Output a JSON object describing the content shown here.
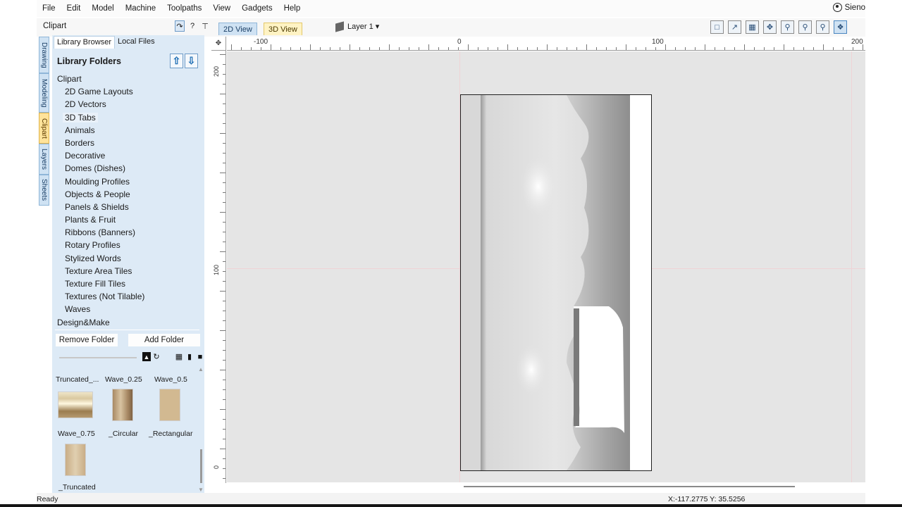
{
  "menu": [
    "File",
    "Edit",
    "Model",
    "Machine",
    "Toolpaths",
    "View",
    "Gadgets",
    "Help"
  ],
  "user": {
    "name": "Sieno"
  },
  "panel": {
    "title": "Clipart",
    "controls": {
      "pin_label": "?",
      "auto_hide": "↑"
    }
  },
  "view_tabs": {
    "tab_2d": "2D View",
    "tab_3d": "3D View"
  },
  "layer": {
    "label": "Layer 1 ▾"
  },
  "toolbar_icons": [
    "fit-view-icon",
    "scale-view-icon",
    "grid-icon",
    "pan-icon",
    "zoom-icon",
    "zoom-box-icon",
    "zoom-extents-icon",
    "vector-toggle-icon"
  ],
  "side_tabs": [
    "Drawing",
    "Modeling",
    "Clipart",
    "Layers",
    "Sheets"
  ],
  "library": {
    "tab_browser": "Library Browser",
    "tab_local": "Local Files",
    "header": "Library Folders",
    "folders": [
      {
        "label": "Clipart",
        "level": 0
      },
      {
        "label": "2D Game Layouts",
        "level": 1
      },
      {
        "label": "2D Vectors",
        "level": 1
      },
      {
        "label": "3D Tabs",
        "level": 1,
        "selected": true
      },
      {
        "label": "Animals",
        "level": 1
      },
      {
        "label": "Borders",
        "level": 1
      },
      {
        "label": "Decorative",
        "level": 1
      },
      {
        "label": "Domes (Dishes)",
        "level": 1
      },
      {
        "label": "Moulding Profiles",
        "level": 1
      },
      {
        "label": "Objects & People",
        "level": 1
      },
      {
        "label": "Panels & Shields",
        "level": 1
      },
      {
        "label": "Plants & Fruit",
        "level": 1
      },
      {
        "label": "Ribbons (Banners)",
        "level": 1
      },
      {
        "label": "Rotary Profiles",
        "level": 1
      },
      {
        "label": "Stylized Words",
        "level": 1
      },
      {
        "label": "Texture Area Tiles",
        "level": 1
      },
      {
        "label": "Texture Fill Tiles",
        "level": 1
      },
      {
        "label": "Textures (Not Tilable)",
        "level": 1
      },
      {
        "label": "Waves",
        "level": 1
      },
      {
        "label": "Design&Make",
        "level": 0
      }
    ],
    "remove_button": "Remove Folder",
    "add_button": "Add Folder"
  },
  "thumbnails": {
    "row1_labels": [
      "Truncated_...",
      "Wave_0.25",
      "Wave_0.5"
    ],
    "row2_labels": [
      "Wave_0.75",
      "_Circular",
      "_Rectangular"
    ],
    "row3_labels": [
      "_Truncated"
    ]
  },
  "ruler": {
    "top_labels": [
      "-100",
      "0",
      "100",
      "200"
    ],
    "left_labels": [
      "200",
      "100",
      "0"
    ]
  },
  "status": {
    "text": "Ready",
    "coords": "X:-117.2775 Y: 35.5256"
  }
}
